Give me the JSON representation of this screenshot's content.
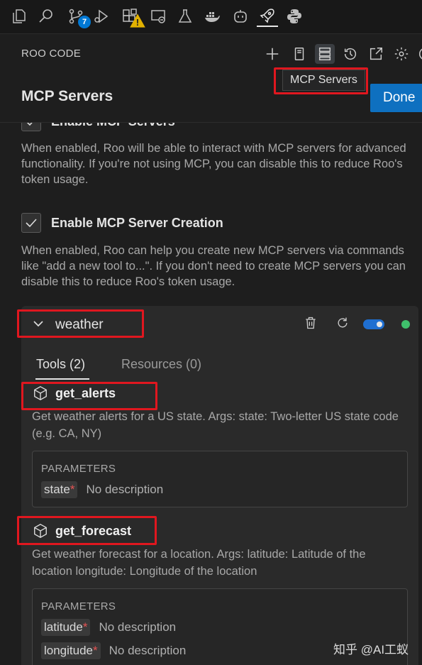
{
  "activity_bar": {
    "items": [
      {
        "name": "explorer-icon"
      },
      {
        "name": "search-icon"
      },
      {
        "name": "source-control-icon",
        "badge": "7"
      },
      {
        "name": "run-debug-icon"
      },
      {
        "name": "extensions-icon",
        "warning": true
      },
      {
        "name": "remote-explorer-icon"
      },
      {
        "name": "testing-icon"
      },
      {
        "name": "docker-icon"
      },
      {
        "name": "copilot-icon"
      },
      {
        "name": "roo-code-icon",
        "active": true
      },
      {
        "name": "python-icon"
      }
    ]
  },
  "header": {
    "title": "ROO CODE",
    "tooltip": "MCP Servers"
  },
  "page": {
    "title": "MCP Servers",
    "done_label": "Done"
  },
  "settings": {
    "enable_mcp": {
      "label": "Enable MCP Servers",
      "checked": true,
      "description": "When enabled, Roo will be able to interact with MCP servers for advanced functionality. If you're not using MCP, you can disable this to reduce Roo's token usage."
    },
    "enable_creation": {
      "label": "Enable MCP Server Creation",
      "checked": true,
      "description": "When enabled, Roo can help you create new MCP servers via commands like \"add a new tool to...\". If you don't need to create MCP servers you can disable this to reduce Roo's token usage."
    }
  },
  "server": {
    "name": "weather",
    "enabled": true,
    "status_color": "#3fbf6b",
    "tabs": [
      {
        "label": "Tools (2)",
        "active": true
      },
      {
        "label": "Resources (0)",
        "active": false
      }
    ],
    "tools": [
      {
        "name": "get_alerts",
        "description": "Get weather alerts for a US state. Args: state: Two-letter US state code (e.g. CA, NY)",
        "params_label": "PARAMETERS",
        "params": [
          {
            "name": "state",
            "required": "*",
            "description": "No description"
          }
        ]
      },
      {
        "name": "get_forecast",
        "description": "Get weather forecast for a location. Args: latitude: Latitude of the location longitude: Longitude of the location",
        "params_label": "PARAMETERS",
        "params": [
          {
            "name": "latitude",
            "required": "*",
            "description": "No description"
          },
          {
            "name": "longitude",
            "required": "*",
            "description": "No description"
          }
        ]
      }
    ]
  },
  "watermark": "知乎 @AI工蚁",
  "colors": {
    "accent": "#0e70c0",
    "highlight_box": "#e0171f",
    "required": "#e55353"
  }
}
